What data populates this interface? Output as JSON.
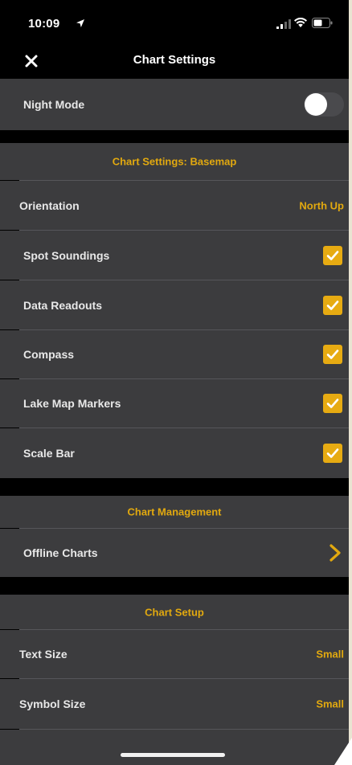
{
  "status_bar": {
    "time": "10:09"
  },
  "nav": {
    "title": "Chart Settings",
    "close_icon": "close-icon"
  },
  "night_mode": {
    "label": "Night Mode",
    "enabled": false
  },
  "basemap": {
    "header": "Chart Settings: Basemap",
    "orientation": {
      "label": "Orientation",
      "value": "North Up"
    },
    "options": [
      {
        "label": "Spot Soundings",
        "checked": true
      },
      {
        "label": "Data Readouts",
        "checked": true
      },
      {
        "label": "Compass",
        "checked": true
      },
      {
        "label": "Lake Map Markers",
        "checked": true
      },
      {
        "label": "Scale Bar",
        "checked": true
      }
    ]
  },
  "management": {
    "header": "Chart Management",
    "offline": {
      "label": "Offline Charts",
      "icon": "chevron-right-icon"
    }
  },
  "setup": {
    "header": "Chart Setup",
    "text_size": {
      "label": "Text Size",
      "value": "Small"
    },
    "symbol_size": {
      "label": "Symbol Size",
      "value": "Small"
    }
  },
  "colors": {
    "accent": "#e2a90f",
    "row_background": "#3c3c3e",
    "background": "#000000"
  }
}
